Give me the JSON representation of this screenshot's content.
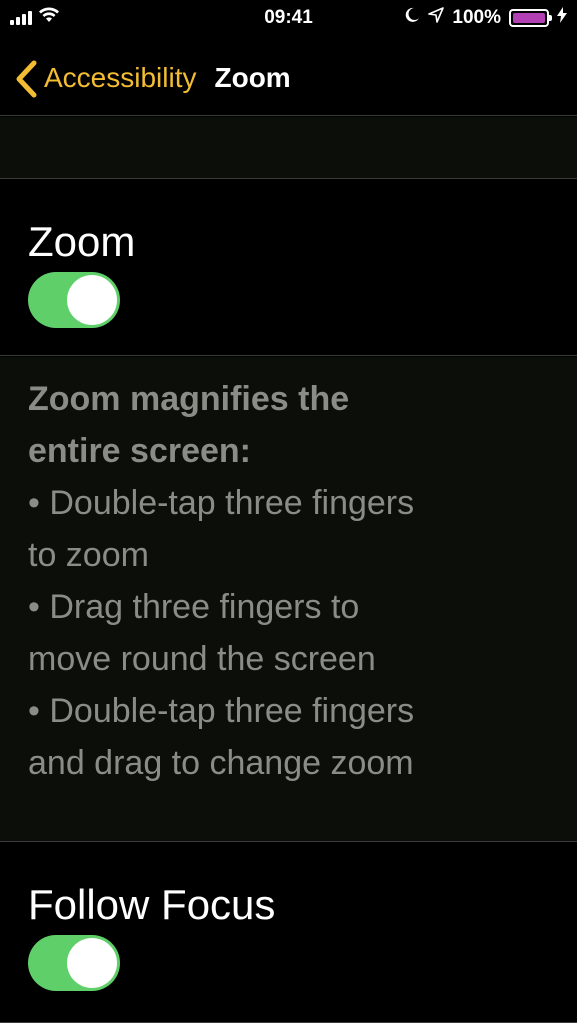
{
  "status_bar": {
    "time": "09:41",
    "battery_text": "100%",
    "battery_level": 100,
    "battery_color": "#b340b3",
    "icons": [
      "signal-icon",
      "wifi-icon",
      "moon-icon",
      "location-icon",
      "battery-icon",
      "charging-icon"
    ]
  },
  "nav": {
    "back_label": "Accessibility",
    "title": "Zoom",
    "accent_color": "#f2bd32"
  },
  "zoom_row": {
    "label": "Zoom",
    "toggle_on": true
  },
  "description": {
    "intro_line1": "Zoom magnifies the",
    "intro_line2": "entire screen:",
    "lines": [
      "Double-tap three fingers",
      "to zoom",
      "Drag three fingers to",
      "move round the screen",
      "Double-tap three fingers",
      "and drag to change zoom"
    ]
  },
  "follow_focus_row": {
    "label": "Follow Focus",
    "toggle_on": true
  },
  "toggle_on_color": "#5fd069"
}
